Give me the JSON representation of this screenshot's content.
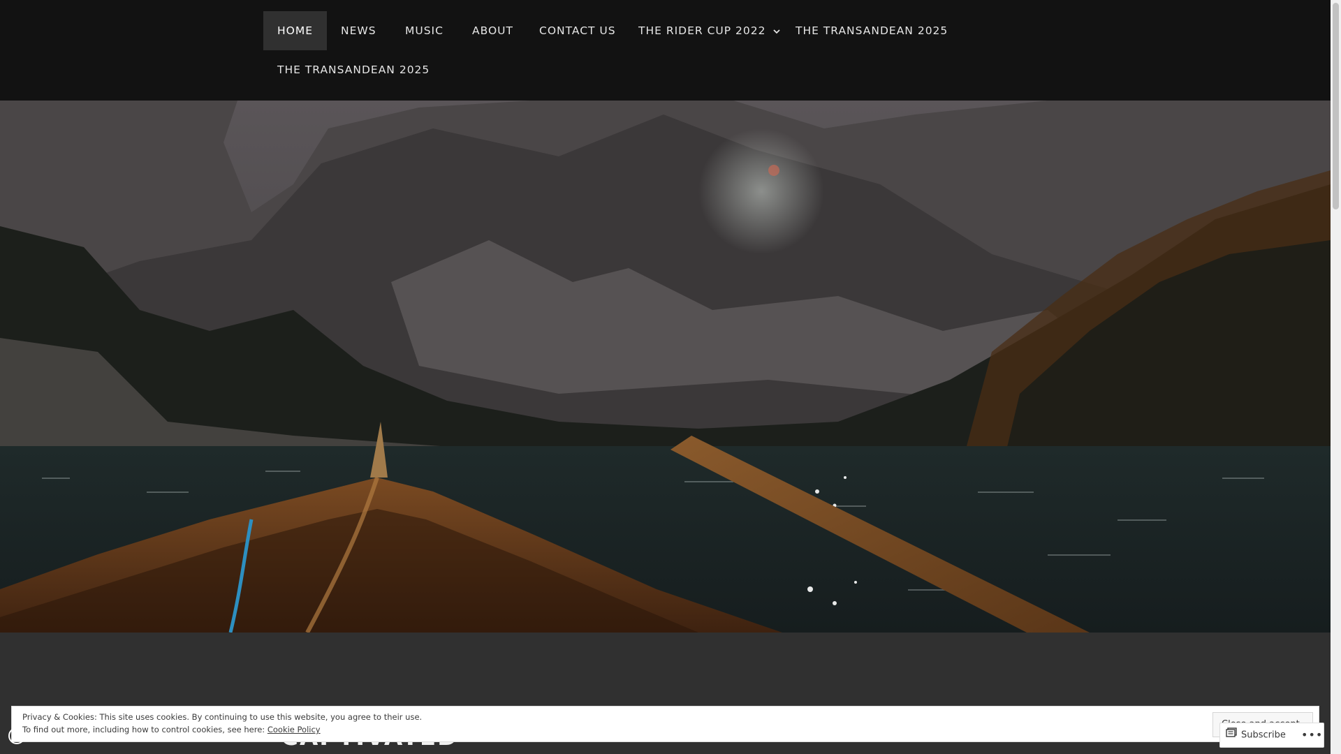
{
  "nav": {
    "items": [
      {
        "label": "HOME",
        "active": true
      },
      {
        "label": "NEWS"
      },
      {
        "label": "MUSIC"
      },
      {
        "label": "ABOUT"
      },
      {
        "label": "CONTACT US"
      },
      {
        "label": "THE RIDER CUP 2022",
        "has_dropdown": true,
        "icon": "chevron-down-icon"
      },
      {
        "label": "THE TRANSANDEAN 2025"
      },
      {
        "label": "THE TRANSANDEAN 2025"
      }
    ]
  },
  "hero": {
    "description_icon": "header-image"
  },
  "post": {
    "title": "CAPTIVATED"
  },
  "cookie": {
    "line1": "Privacy & Cookies: This site uses cookies. By continuing to use this website, you agree to their use.",
    "line2_prefix": "To find out more, including how to control cookies, see here: ",
    "link_label": "Cookie Policy",
    "button_label": "Close and accept"
  },
  "subscribe": {
    "label": "Subscribe",
    "icon": "reader-icon",
    "more_label": "•••"
  },
  "colors": {
    "nav_bg": "#121212",
    "active_bg": "#303030",
    "page_bg": "#303030",
    "nav_text": "#e6e6e6"
  }
}
